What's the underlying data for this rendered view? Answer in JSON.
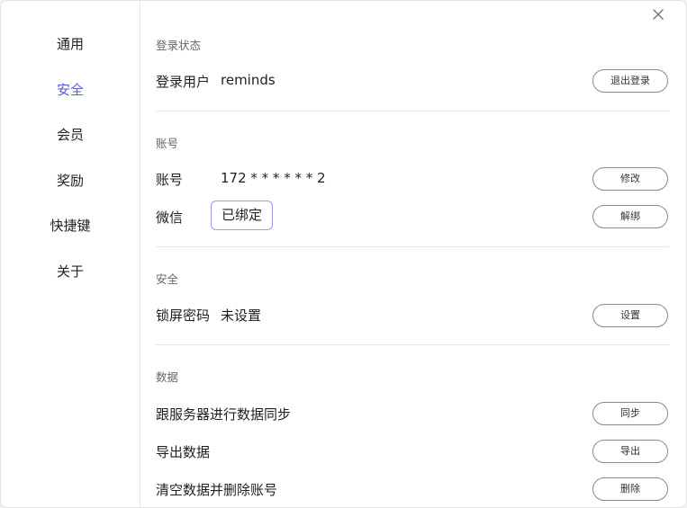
{
  "sidebar": {
    "items": [
      {
        "label": "通用",
        "active": false
      },
      {
        "label": "安全",
        "active": true
      },
      {
        "label": "会员",
        "active": false
      },
      {
        "label": "奖励",
        "active": false
      },
      {
        "label": "快捷键",
        "active": false
      },
      {
        "label": "关于",
        "active": false
      }
    ]
  },
  "sections": {
    "login": {
      "title": "登录状态",
      "user_label": "登录用户",
      "user_value": "reminds",
      "logout_button": "退出登录"
    },
    "account": {
      "title": "账号",
      "account_label": "账号",
      "account_value": "172 * * * * * * 2",
      "modify_button": "修改",
      "wechat_label": "微信",
      "wechat_value": "已绑定",
      "unbind_button": "解绑"
    },
    "security": {
      "title": "安全",
      "lock_label": "锁屏密码",
      "lock_value": "未设置",
      "set_button": "设置"
    },
    "data": {
      "title": "数据",
      "sync_label": "跟服务器进行数据同步",
      "sync_button": "同步",
      "export_label": "导出数据",
      "export_button": "导出",
      "clear_label": "清空数据并删除账号",
      "delete_button": "删除"
    }
  },
  "colors": {
    "accent": "#5b5bd6",
    "bound_border": "#9a9ae6"
  },
  "icons": {
    "close": "close-icon"
  }
}
